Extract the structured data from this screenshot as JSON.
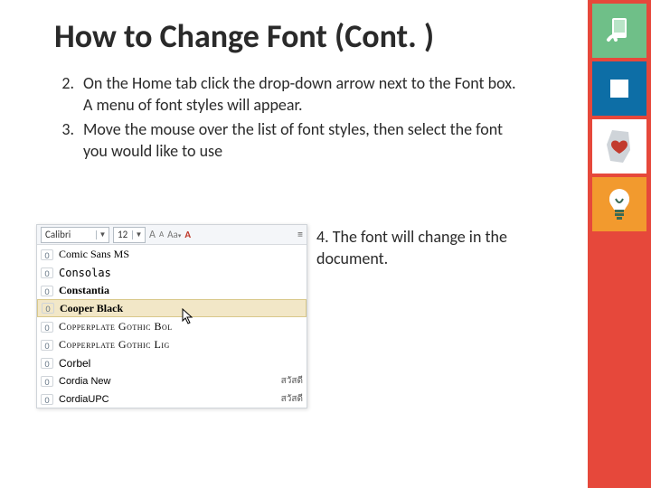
{
  "title": "How to Change Font (Cont. )",
  "steps": {
    "s2_num": "2.",
    "s2_text": "On the Home tab click the drop-down arrow next to the Font box.  A menu of font styles will appear.",
    "s3_num": "3.",
    "s3_text": "Move the mouse over the list of font styles, then select the font you would like to use",
    "s4_text": "4.  The font will change in the document."
  },
  "dropdown": {
    "font_value": "Calibri",
    "size_value": "12",
    "btn_grow": "A",
    "btn_shrink": "A",
    "btn_case": "Aa",
    "btn_clear": "A",
    "zero_glyph": "0",
    "items": [
      {
        "name": "Comic Sans MS",
        "cls": "f-comic",
        "sample": ""
      },
      {
        "name": "Consolas",
        "cls": "f-consolas",
        "sample": ""
      },
      {
        "name": "Constantia",
        "cls": "f-constantia",
        "sample": ""
      },
      {
        "name": "Cooper Black",
        "cls": "f-cooper",
        "sample": "",
        "hover": true
      },
      {
        "name": "Copperplate Gothic Bol",
        "cls": "f-copper",
        "sample": ""
      },
      {
        "name": "Copperplate Gothic Lig",
        "cls": "f-copper",
        "sample": ""
      },
      {
        "name": "Corbel",
        "cls": "f-corbel",
        "sample": ""
      },
      {
        "name": "Cordia New",
        "cls": "f-cordia",
        "sample": "สวัสดี"
      },
      {
        "name": "CordiaUPC",
        "cls": "f-cordia",
        "sample": "สวัสดี"
      }
    ]
  }
}
